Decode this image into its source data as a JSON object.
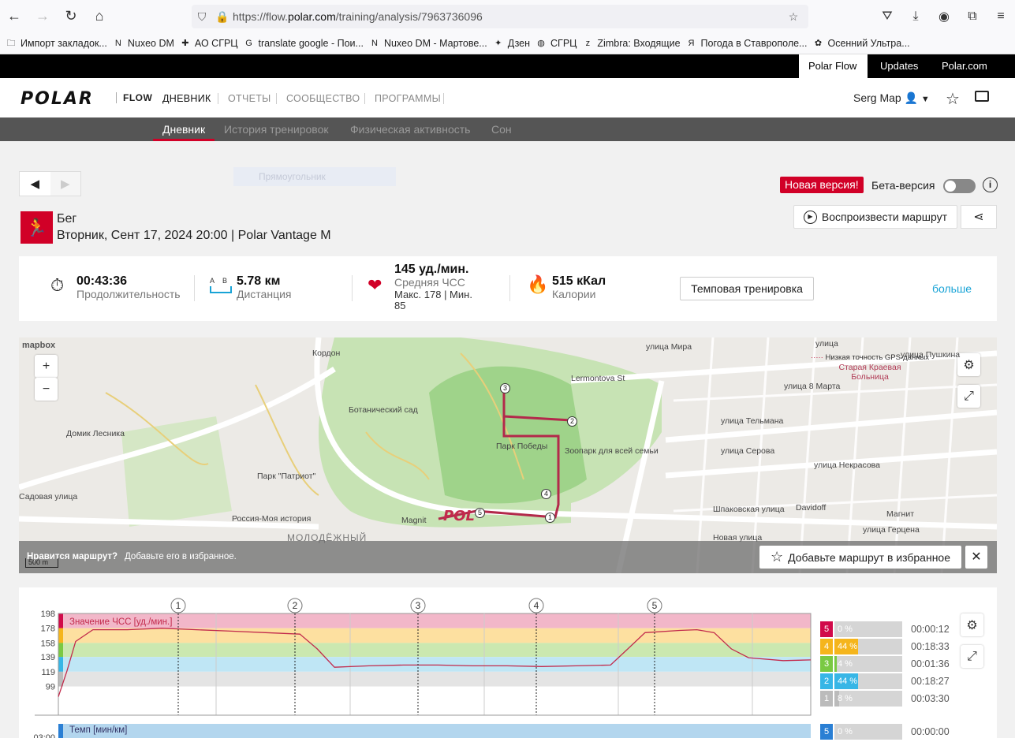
{
  "browser": {
    "url_prefix": "https://flow.",
    "url_domain": "polar.com",
    "url_path": "/training/analysis/7963736096"
  },
  "bookmarks": [
    {
      "label": "Импорт закладок...",
      "icon": "folder-icon"
    },
    {
      "label": "Nuxeo DM",
      "icon": "nuxeo-icon"
    },
    {
      "label": "АО СГРЦ",
      "icon": "sgrc-icon"
    },
    {
      "label": "translate google - Пои...",
      "icon": "google-icon"
    },
    {
      "label": "Nuxeo DM - Мартове...",
      "icon": "nuxeo-icon"
    },
    {
      "label": "Дзен",
      "icon": "dzen-icon"
    },
    {
      "label": "СГРЦ",
      "icon": "globe-icon"
    },
    {
      "label": "Zimbra: Входящие",
      "icon": "zimbra-icon"
    },
    {
      "label": "Погода в Ставрополе...",
      "icon": "yandex-icon"
    },
    {
      "label": "Осенний Ультра...",
      "icon": "maple-icon"
    }
  ],
  "topbar": {
    "polar_flow": "Polar Flow",
    "updates": "Updates",
    "polar_com": "Polar.com"
  },
  "mainnav": {
    "logo": "POLAR",
    "flow": "FLOW",
    "items": [
      "ДНЕВНИК",
      "ОТЧЕТЫ",
      "СООБЩЕСТВО",
      "ПРОГРАММЫ"
    ],
    "user": "Serg Map"
  },
  "subnav": [
    "Дневник",
    "История тренировок",
    "Физическая активность",
    "Сон"
  ],
  "ghost_label": "Прямоугольник",
  "header": {
    "new_version": "Новая версия!",
    "beta": "Бета-версия",
    "sport": "Бег",
    "date": "Вторник, Сент 17, 2024 20:00 | Polar Vantage M",
    "replay": "Воспроизвести маршрут"
  },
  "summary": {
    "duration_val": "00:43:36",
    "duration_lbl": "Продолжительность",
    "distance_val": "5.78 км",
    "distance_lbl": "Дистанция",
    "dist_a": "A",
    "dist_b": "B",
    "hr_val": "145 уд./мин.",
    "hr_lbl": "Средняя ЧСС",
    "hr_max": "Макс. 178  |  Мин.",
    "hr_min": "85",
    "cal_val": "515 кКал",
    "cal_lbl": "Калории",
    "tag": "Темповая тренировка",
    "more": "больше"
  },
  "map": {
    "brand": "mapbox",
    "legend": "Низкая точность GPS-данных",
    "scale": "500 m",
    "labels": [
      "улица Мира",
      "Кордон",
      "Lermontova St",
      "Старая Краевая Больница",
      "улица 8 Марта",
      "Ботанический сад",
      "Домик Лесника",
      "улица Тельмана",
      "Парк Победы",
      "Зоопарк для всей семьи",
      "улица Серова",
      "улица Некрасова",
      "Парк \"Патриот\"",
      "Садовая улица",
      "Россия-Моя история",
      "Magnit",
      "Шпаковская улица",
      "Davidoff",
      "Магнит",
      "Новая улица",
      "улица Герцена",
      "МОЛОДЁЖНЫЙ",
      "улица Пушкина",
      "улица"
    ],
    "laps": [
      "1",
      "2",
      "3",
      "4",
      "5"
    ],
    "fav_q": "Нравится маршрут?",
    "fav_hint": "Добавьте его в избранное.",
    "fav_btn": "Добавьте маршрут в избранное",
    "close": "✕"
  },
  "chart_data": [
    {
      "type": "line",
      "title": "Значение ЧСС [уд./мин.]",
      "ylabel": "Значение ЧСС [уд./мин.]",
      "y_ticks": [
        198,
        178,
        158,
        139,
        119,
        99
      ],
      "ylim": [
        60,
        198
      ],
      "lap_markers": [
        "1",
        "2",
        "3",
        "4",
        "5"
      ],
      "series": [
        {
          "name": "Значение ЧСС [уд./мин.]",
          "x_minutes": [
            0,
            0.5,
            1,
            2,
            4,
            6,
            8,
            10,
            12,
            14,
            15,
            16,
            18,
            20,
            22,
            24,
            26,
            28,
            30,
            32,
            33,
            34,
            36,
            37,
            38,
            39,
            40,
            42,
            43.6
          ],
          "values": [
            85,
            120,
            160,
            176,
            176,
            178,
            176,
            174,
            172,
            170,
            150,
            125,
            127,
            128,
            128,
            127,
            127,
            126,
            127,
            128,
            150,
            172,
            175,
            176,
            172,
            150,
            138,
            134,
            135
          ]
        }
      ]
    },
    {
      "type": "bar",
      "title": "Зоны ЧСС",
      "categories": [
        "5",
        "4",
        "3",
        "2",
        "1"
      ],
      "percent": [
        0,
        44,
        4,
        44,
        8
      ],
      "times": [
        "00:00:12",
        "00:18:33",
        "00:01:36",
        "00:18:27",
        "00:03:30"
      ]
    }
  ],
  "pace": {
    "label": "Темп [мин/км]",
    "y_tick": "03:00",
    "zone": "5",
    "pct": "0 %",
    "time": "00:00:00"
  },
  "zone_colors": {
    "5": "#d10a4a",
    "4": "#f5b51c",
    "3": "#7ac943",
    "2": "#37b6e6",
    "1": "#bbbbbb"
  }
}
